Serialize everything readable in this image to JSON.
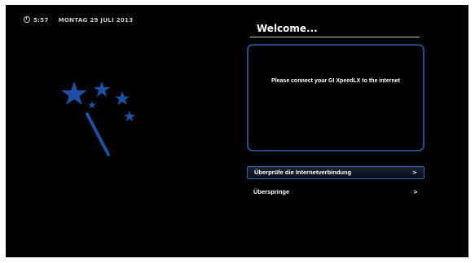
{
  "status_bar": {
    "time": "5:57",
    "date": "MONTAG 29 JULI 2013"
  },
  "welcome": {
    "title": "Welcome..."
  },
  "message": {
    "text": "Please connect your GI XpeedLX to the internet"
  },
  "menu": {
    "items": [
      {
        "label": "Überprüfe die Internetverbindung",
        "arrow": ">",
        "selected": true
      },
      {
        "label": "Überspringe",
        "arrow": ">",
        "selected": false
      }
    ]
  },
  "colors": {
    "background": "#000000",
    "accent_blue": "#1e4fa0",
    "frame_blue": "#2d4a8a",
    "text": "#ffffff"
  },
  "icons": {
    "clock": "clock-icon",
    "wizard": "magic-wand-icon"
  }
}
